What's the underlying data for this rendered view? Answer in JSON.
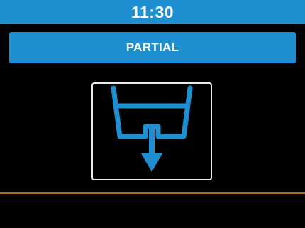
{
  "status_bar": {
    "time": "11:30"
  },
  "mode": {
    "label": "PARTIAL"
  },
  "main": {
    "icon": "partial-drain-icon"
  },
  "colors": {
    "accent": "#1f8fd2",
    "background": "#000000",
    "divider": "#b86a1c",
    "frame": "#e8e8e8"
  }
}
